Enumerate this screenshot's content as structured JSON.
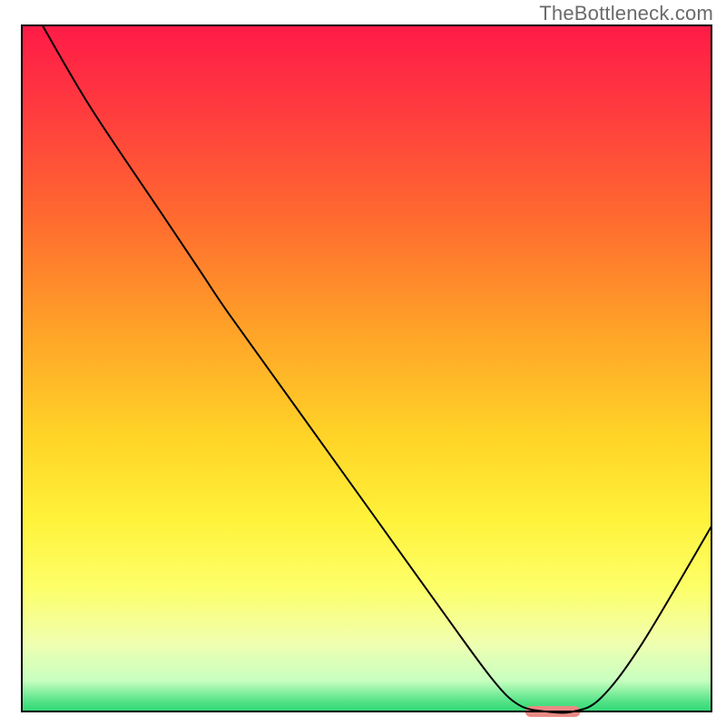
{
  "watermark": "TheBottleneck.com",
  "chart_data": {
    "type": "line",
    "title": "",
    "xlabel": "",
    "ylabel": "",
    "xlim": [
      0,
      100
    ],
    "ylim": [
      0,
      100
    ],
    "background_gradient": {
      "stops": [
        {
          "offset": 0.0,
          "color": "#ff1b47"
        },
        {
          "offset": 0.12,
          "color": "#ff3a3f"
        },
        {
          "offset": 0.28,
          "color": "#ff6a2f"
        },
        {
          "offset": 0.44,
          "color": "#ffa128"
        },
        {
          "offset": 0.6,
          "color": "#ffd427"
        },
        {
          "offset": 0.72,
          "color": "#fff23a"
        },
        {
          "offset": 0.82,
          "color": "#fdff69"
        },
        {
          "offset": 0.9,
          "color": "#f0ffb0"
        },
        {
          "offset": 0.955,
          "color": "#c8ffc0"
        },
        {
          "offset": 0.985,
          "color": "#55e388"
        },
        {
          "offset": 1.0,
          "color": "#2fd874"
        }
      ]
    },
    "series": [
      {
        "name": "bottleneck-curve",
        "color": "#000000",
        "x": [
          3,
          10,
          20,
          26,
          30,
          40,
          50,
          60,
          68,
          72,
          76,
          80,
          84,
          90,
          100
        ],
        "y": [
          100,
          88,
          73,
          64,
          58,
          44,
          30,
          16,
          5,
          1,
          0,
          0,
          2,
          10,
          27
        ]
      }
    ],
    "marker": {
      "name": "optimal-range",
      "color": "#e98a84",
      "x_center": 77,
      "y": 0,
      "width": 8,
      "height": 1.6,
      "rx": 1
    },
    "frame": {
      "color": "#000000",
      "width": 2
    }
  }
}
